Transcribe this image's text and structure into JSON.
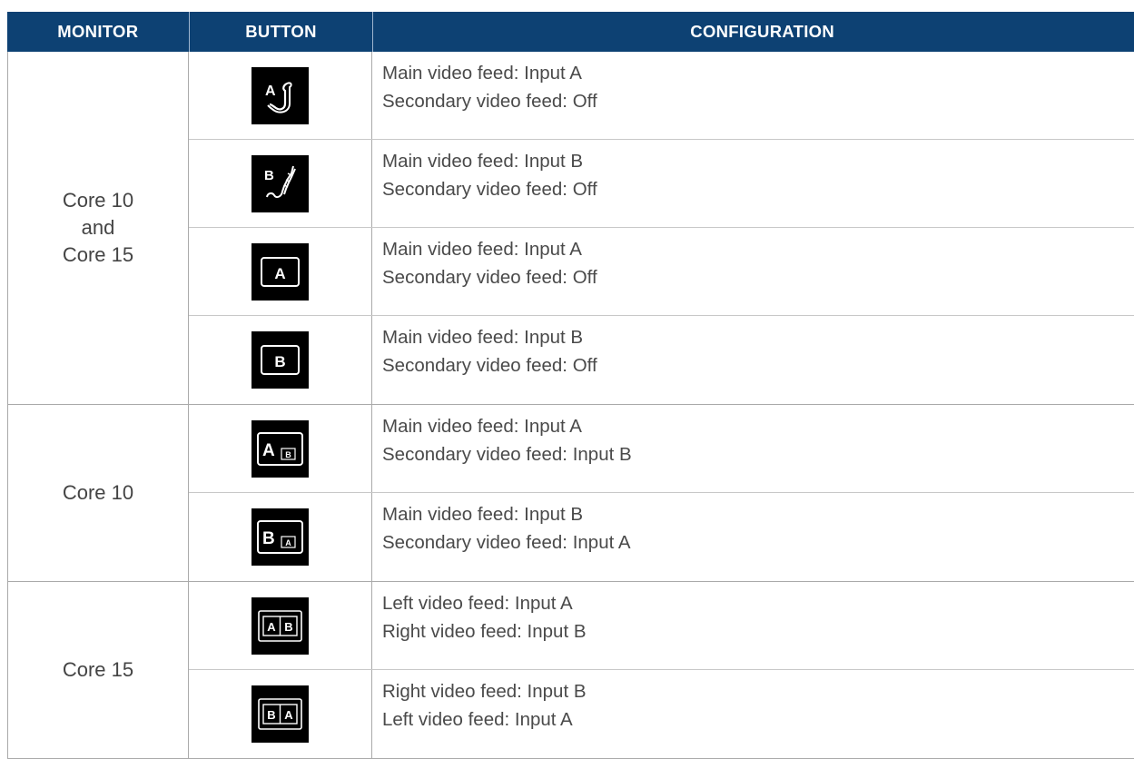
{
  "header": {
    "monitor": "MONITOR",
    "button": "BUTTON",
    "configuration": "CONFIGURATION"
  },
  "groups": [
    {
      "monitor": [
        "Core 10",
        "and",
        "Core 15"
      ],
      "rows": [
        {
          "icon": "scope-a-icon",
          "line1": "Main video feed: Input A",
          "line2": "Secondary video feed: Off"
        },
        {
          "icon": "scope-b-icon",
          "line1": "Main video feed: Input B",
          "line2": "Secondary video feed: Off"
        },
        {
          "icon": "screen-a-icon",
          "line1": "Main video feed: Input A",
          "line2": "Secondary video feed: Off"
        },
        {
          "icon": "screen-b-icon",
          "line1": "Main video feed: Input B",
          "line2": "Secondary video feed: Off"
        }
      ]
    },
    {
      "monitor": [
        "Core 10"
      ],
      "rows": [
        {
          "icon": "pip-a-b-icon",
          "line1": "Main video feed: Input A",
          "line2": "Secondary video feed: Input B"
        },
        {
          "icon": "pip-b-a-icon",
          "line1": "Main video feed: Input B",
          "line2": "Secondary video feed: Input A"
        }
      ]
    },
    {
      "monitor": [
        "Core 15"
      ],
      "rows": [
        {
          "icon": "split-a-b-icon",
          "line1": "Left video feed: Input A",
          "line2": "Right video feed: Input B"
        },
        {
          "icon": "split-b-a-icon",
          "line1": "Right video feed: Input B",
          "line2": "Left video feed: Input A"
        }
      ]
    }
  ]
}
